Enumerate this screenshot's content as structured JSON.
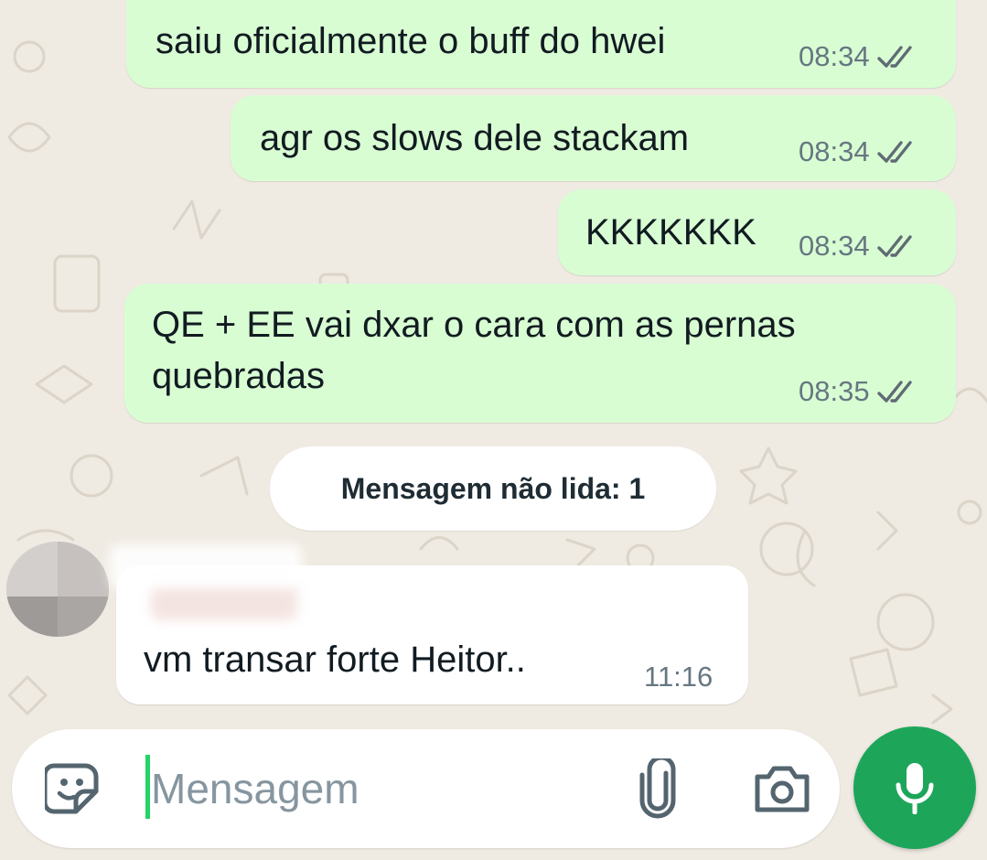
{
  "theme": {
    "outgoing_bubble": "#d9fdd3",
    "incoming_bubble": "#ffffff",
    "accent_green": "#1da65a",
    "read_check": "#667781"
  },
  "messages": [
    {
      "direction": "outgoing",
      "text": "saiu oficialmente o buff do hwei",
      "time": "08:34",
      "status_icon": "double-check-icon"
    },
    {
      "direction": "outgoing",
      "text": "agr os slows dele stackam",
      "time": "08:34",
      "status_icon": "double-check-icon"
    },
    {
      "direction": "outgoing",
      "text": "KKKKKKK",
      "time": "08:34",
      "status_icon": "double-check-icon"
    },
    {
      "direction": "outgoing",
      "lines": [
        "QE + EE vai dxar o cara com as pernas",
        "quebradas"
      ],
      "time": "08:35",
      "status_icon": "double-check-icon"
    }
  ],
  "unread_separator": "Mensagem não lida: 1",
  "incoming_message": {
    "text": "vm transar forte Heitor..",
    "time": "11:16",
    "sender_name_redacted": true
  },
  "composer": {
    "placeholder": "Mensagem",
    "sticker_icon": "sticker-icon",
    "attach_icon": "paperclip-icon",
    "camera_icon": "camera-icon",
    "mic_icon": "microphone-icon"
  }
}
